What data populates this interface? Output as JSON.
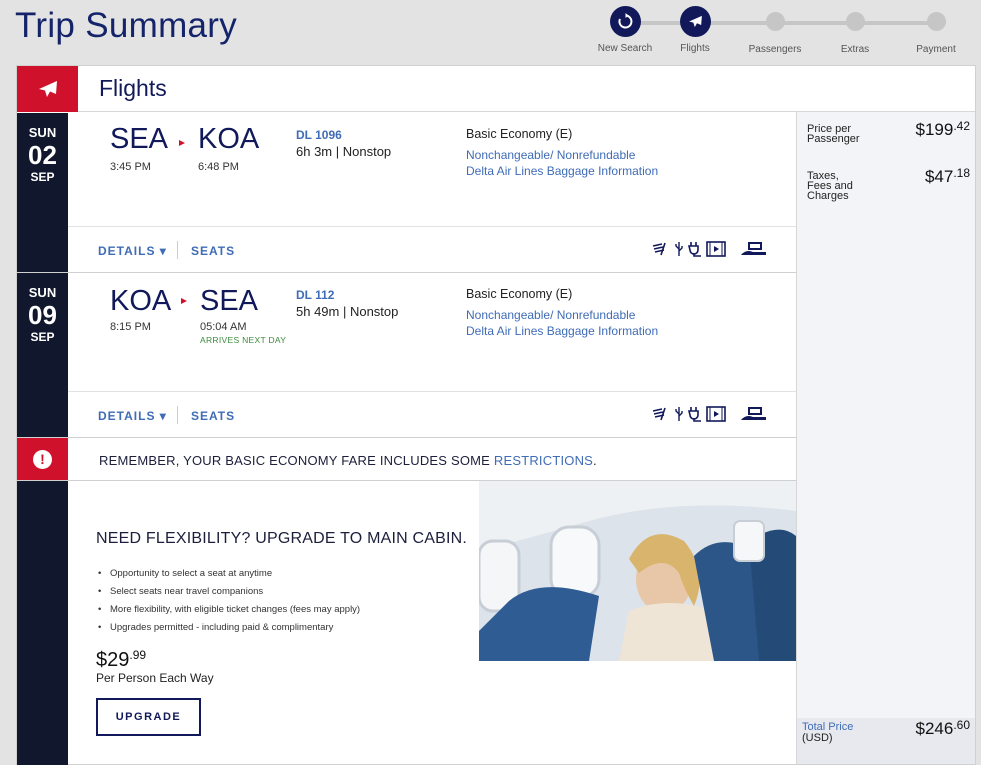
{
  "page": {
    "title": "Trip Summary"
  },
  "stepper": {
    "steps": [
      {
        "label": "New Search"
      },
      {
        "label": "Flights"
      },
      {
        "label": "Passengers"
      },
      {
        "label": "Extras"
      },
      {
        "label": "Payment"
      }
    ]
  },
  "flights_section": {
    "title": "Flights"
  },
  "segments": [
    {
      "dow": "SUN",
      "day": "02",
      "month": "SEP",
      "origin": "SEA",
      "dest": "KOA",
      "depart_time": "3:45 PM",
      "arrive_time": "6:48 PM",
      "arrives_note": "",
      "flight_number": "DL 1096",
      "duration": "6h 3m | Nonstop",
      "fare_class": "Basic Economy (E)",
      "fare_link": "Nonchangeable/ Nonrefundable",
      "baggage_link": "Delta Air Lines Baggage Information",
      "details_label": "DETAILS ▾",
      "seats_label": "SEATS"
    },
    {
      "dow": "SUN",
      "day": "09",
      "month": "SEP",
      "origin": "KOA",
      "dest": "SEA",
      "depart_time": "8:15 PM",
      "arrive_time": "05:04 AM",
      "arrives_note": "ARRIVES NEXT DAY",
      "flight_number": "DL 112",
      "duration": "5h 49m | Nonstop",
      "fare_class": "Basic Economy (E)",
      "fare_link": "Nonchangeable/ Nonrefundable",
      "baggage_link": "Delta Air Lines Baggage Information",
      "details_label": "DETAILS ▾",
      "seats_label": "SEATS"
    }
  ],
  "pricing": {
    "per_passenger_label": "Price per Passenger",
    "per_passenger_dollars": "$199",
    "per_passenger_cents": ".42",
    "taxes_label": "Taxes, Fees and Charges",
    "taxes_dollars": "$47",
    "taxes_cents": ".18",
    "total_label": "Total Price",
    "total_currency": "(USD)",
    "total_dollars": "$246",
    "total_cents": ".60"
  },
  "restrictions": {
    "text": "REMEMBER, YOUR BASIC ECONOMY FARE INCLUDES SOME ",
    "link": "RESTRICTIONS",
    "end": "."
  },
  "upsell": {
    "title": "NEED FLEXIBILITY? UPGRADE TO MAIN CABIN.",
    "bullets": [
      "Opportunity to select a seat at anytime",
      "Select seats near travel companions",
      "More flexibility, with eligible ticket changes (fees may apply)",
      "Upgrades permitted - including paid & complimentary"
    ],
    "price_dollars": "$29",
    "price_cents": ".99",
    "price_note": "Per Person Each Way",
    "button_label": "UPGRADE"
  },
  "colors": {
    "brand_red": "#d0112b",
    "navy": "#11195a",
    "link_blue": "#3f6cb6",
    "rail": "#11172d"
  },
  "icons": [
    "plane-icon",
    "refresh-icon",
    "wifi-icon",
    "usb-icon",
    "power-icon",
    "entertainment-icon",
    "seat-icon",
    "alert-icon"
  ]
}
